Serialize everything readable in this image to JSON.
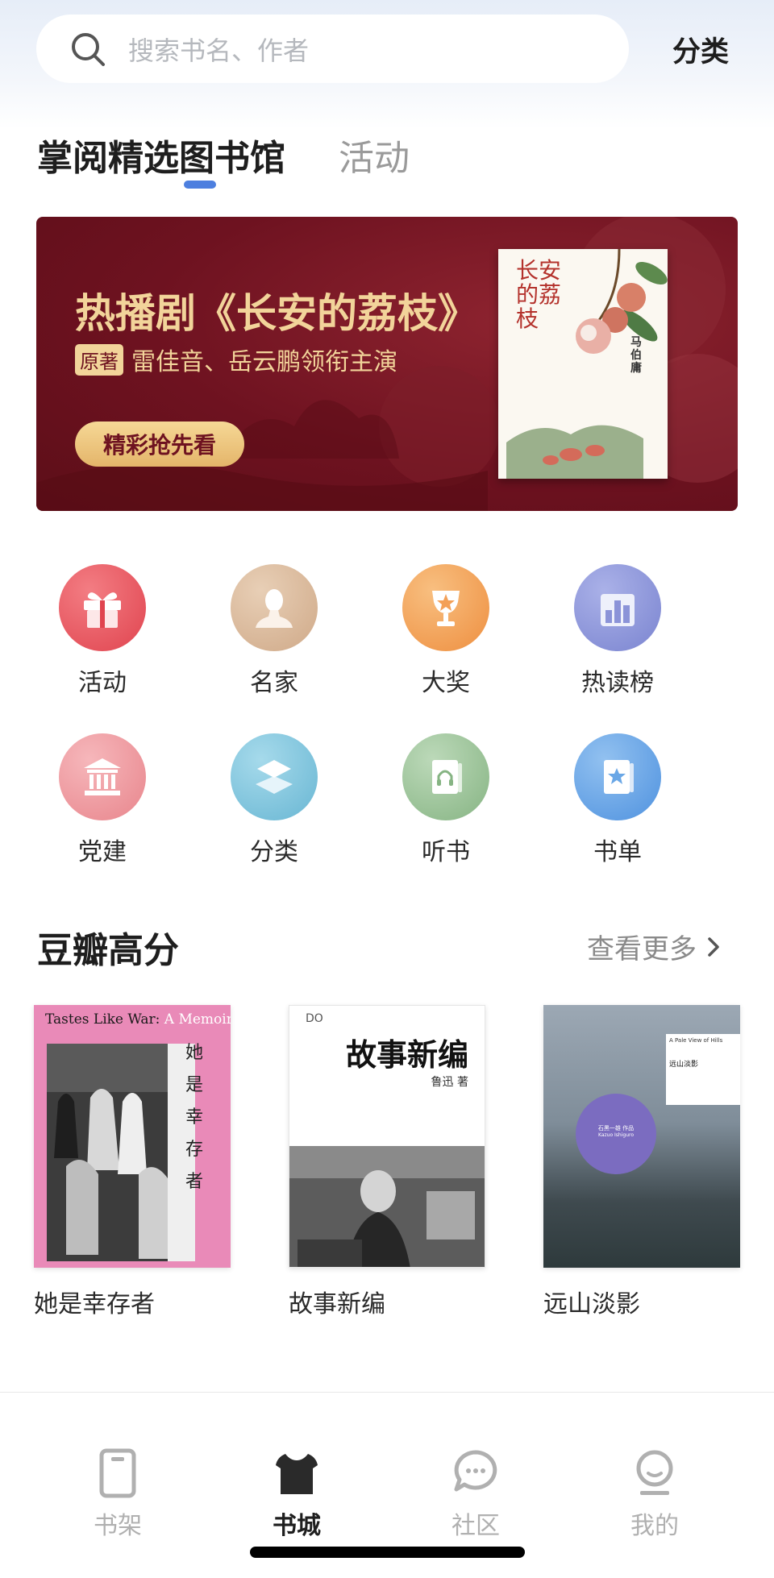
{
  "header": {
    "search_placeholder": "搜索书名、作者",
    "category_link": "分类"
  },
  "tabs": [
    {
      "label": "掌阅精选图书馆",
      "active": true
    },
    {
      "label": "活动",
      "active": false
    }
  ],
  "banner": {
    "title": "热播剧《长安的荔枝》",
    "badge": "原著",
    "subtitle": "雷佳音、岳云鹏领衔主演",
    "button": "精彩抢先看",
    "book_title": "长安的荔枝",
    "book_author": "马伯庸",
    "colors": {
      "background": "#6e1220",
      "gold": "#f2d49a"
    }
  },
  "quick_entries": [
    {
      "label": "活动",
      "icon": "gift-icon",
      "color": "#e8505b"
    },
    {
      "label": "名家",
      "icon": "bust-icon",
      "color": "#d9b99a"
    },
    {
      "label": "大奖",
      "icon": "trophy-icon",
      "color": "#f3a058"
    },
    {
      "label": "热读榜",
      "icon": "chart-bars-icon",
      "color": "#8b93d8"
    },
    {
      "label": "党建",
      "icon": "building-icon",
      "color": "#ee9aa0"
    },
    {
      "label": "分类",
      "icon": "layers-icon",
      "color": "#7ec3dc"
    },
    {
      "label": "听书",
      "icon": "headphone-book-icon",
      "color": "#9cc59a"
    },
    {
      "label": "书单",
      "icon": "star-book-icon",
      "color": "#6aa7e6"
    }
  ],
  "section": {
    "title": "豆瓣高分",
    "more": "查看更多"
  },
  "books": [
    {
      "title": "她是幸存者",
      "cover_en": "Tastes Like War:",
      "cover_en2": "A Memoir",
      "cover_cn": "她是幸存者"
    },
    {
      "title": "故事新编",
      "cover_cn": "故事新编",
      "cover_author": "鲁迅 著"
    },
    {
      "title": "远山淡影",
      "cover_en": "A Pale View of Hills",
      "cover_cn": "远山淡影",
      "cover_author_cn": "石黑一雄 作品",
      "cover_author_en": "Kazuo Ishiguro"
    }
  ],
  "bottom_nav": [
    {
      "label": "书架",
      "icon": "bookshelf-icon",
      "active": false
    },
    {
      "label": "书城",
      "icon": "store-icon",
      "active": true
    },
    {
      "label": "社区",
      "icon": "chat-bubble-icon",
      "active": false
    },
    {
      "label": "我的",
      "icon": "profile-icon",
      "active": false
    }
  ]
}
